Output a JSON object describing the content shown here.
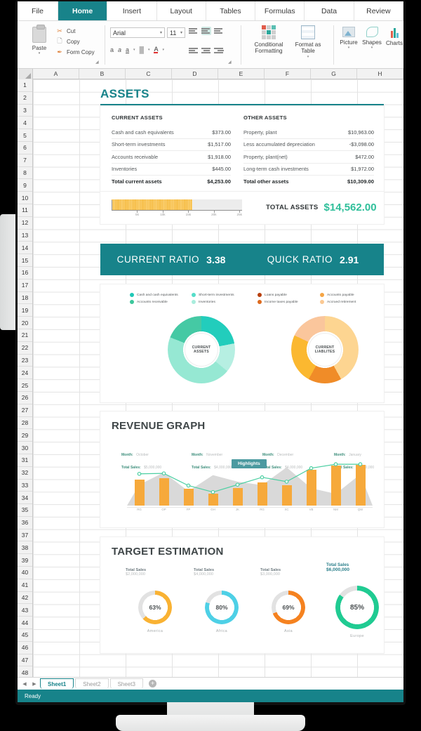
{
  "ribbon": {
    "tabs": [
      {
        "label": "File",
        "active": false
      },
      {
        "label": "Home",
        "active": true
      },
      {
        "label": "Insert",
        "active": false
      },
      {
        "label": "Layout",
        "active": false
      },
      {
        "label": "Tables",
        "active": false
      },
      {
        "label": "Formulas",
        "active": false
      },
      {
        "label": "Data",
        "active": false
      },
      {
        "label": "Review",
        "active": false
      }
    ],
    "clipboard": {
      "paste": "Paste",
      "cut": "Cut",
      "copy": "Copy",
      "format_copy": "Form Copy"
    },
    "font": {
      "family": "Arial",
      "size": "11"
    },
    "commands": {
      "conditional_formatting": "Conditional Formatting",
      "format_as_table": "Format as Table",
      "picture": "Picture",
      "shapes": "Shapes",
      "charts": "Charts"
    }
  },
  "grid": {
    "columns": [
      "A",
      "B",
      "C",
      "D",
      "E",
      "F",
      "G",
      "H"
    ],
    "row_count": 52
  },
  "dashboard": {
    "assets": {
      "title": "ASSETS",
      "current": {
        "heading": "CURRENT ASSETS",
        "rows": [
          {
            "label": "Cash and cash equivalents",
            "value": "$373.00"
          },
          {
            "label": "Short-term investments",
            "value": "$1,517.00"
          },
          {
            "label": "Accounts receivable",
            "value": "$1,918.00"
          },
          {
            "label": "Inventories",
            "value": "$445.00"
          }
        ],
        "total": {
          "label": "Total current assets",
          "value": "$4,253.00"
        }
      },
      "other": {
        "heading": "OTHER ASSETS",
        "rows": [
          {
            "label": "Property, plant",
            "value": "$10,963.00"
          },
          {
            "label": "Less accumulated depreciation",
            "value": "-$3,098.00"
          },
          {
            "label": "Property, plant(net)",
            "value": "$472.00"
          },
          {
            "label": "Long-term cash investments",
            "value": "$1,972.00"
          }
        ],
        "total": {
          "label": "Total other assets",
          "value": "$10,309.00"
        }
      },
      "total_assets": {
        "label": "TOTAL ASSETS",
        "value": "$14,562.00",
        "bar_percent": 62,
        "axis_ticks": [
          "5k",
          "10k",
          "15k",
          "20k",
          "25k"
        ]
      }
    },
    "ratios": [
      {
        "name": "CURRENT RATIO",
        "value": "3.38"
      },
      {
        "name": "QUICK RATIO",
        "value": "2.91"
      }
    ],
    "donuts": {
      "assets": {
        "center_line1": "CURRENT",
        "center_line2": "ASSETS",
        "legend": [
          {
            "label": "Cash and cash equivalents",
            "color": "#1fc8b6"
          },
          {
            "label": "Short-term investments",
            "color": "#55ddc9"
          },
          {
            "label": "Accounts receivable",
            "color": "#3cc79c"
          },
          {
            "label": "Inventories",
            "color": "#a9eddd"
          }
        ],
        "segments": [
          {
            "name": "Cash and cash equivalents",
            "value": 22,
            "color": "#22cdbc"
          },
          {
            "name": "Inventories",
            "value": 14,
            "color": "#b6efe2"
          },
          {
            "name": "Short-term investments",
            "value": 45,
            "color": "#96e8d3"
          },
          {
            "name": "Accounts receivable",
            "value": 19,
            "color": "#45c9a4"
          }
        ]
      },
      "liabilities": {
        "center_line1": "CURRENT",
        "center_line2": "LIABLITES",
        "legend": [
          {
            "label": "Loans payable",
            "color": "#b8400d"
          },
          {
            "label": "Accounts payable",
            "color": "#f5a545"
          },
          {
            "label": "Income taxes payable",
            "color": "#dd6a1e"
          },
          {
            "label": "Accrued retirement",
            "color": "#fbc993"
          }
        ],
        "segments": [
          {
            "name": "Accounts payable",
            "value": 42,
            "color": "#fdd591"
          },
          {
            "name": "Income taxes payable",
            "value": 16,
            "color": "#f08c28"
          },
          {
            "name": "Loans payable",
            "value": 24,
            "color": "#fbb830"
          },
          {
            "name": "Accrued retirement",
            "value": 18,
            "color": "#fac69c"
          }
        ]
      }
    },
    "revenue": {
      "title": "REVENUE GRAPH",
      "months": [
        {
          "month_key": "Month:",
          "month": "October",
          "sales_key": "Total Sales:",
          "sales": "$5,000,000"
        },
        {
          "month_key": "Month:",
          "month": "November",
          "sales_key": "Total Sales:",
          "sales": "$4,000,000"
        },
        {
          "month_key": "Month:",
          "month": "December",
          "sales_key": "Total Sales:",
          "sales": "$4,000,000"
        },
        {
          "month_key": "Month:",
          "month": "January",
          "sales_key": "Total Sales:",
          "sales": "$4,000,000"
        }
      ],
      "highlight_pill": "Highlights",
      "chart": {
        "categories": [
          "RG",
          "OP",
          "FP",
          "GH",
          "JK",
          "RG",
          "XC",
          "VB",
          "NM",
          "QW"
        ],
        "bars": [
          60,
          63,
          38,
          27,
          41,
          53,
          47,
          83,
          92,
          93
        ],
        "line": [
          73,
          74,
          46,
          31,
          48,
          65,
          55,
          86,
          95,
          95
        ],
        "area": [
          48,
          76,
          33,
          70,
          55,
          47,
          88,
          40,
          27,
          72
        ]
      }
    },
    "target": {
      "title": "TARGET ESTIMATION",
      "kpis": [
        {
          "label": "Total Sales",
          "value": "$2,000,000",
          "highlight": false
        },
        {
          "label": "Total Sales",
          "value": "$4,000,000",
          "highlight": false
        },
        {
          "label": "Total Sales",
          "value": "$3,000,000",
          "highlight": false
        },
        {
          "label": "Total Sales",
          "value": "$6,000,000",
          "highlight": true
        }
      ],
      "gauges": [
        {
          "name": "America",
          "percent": "63%",
          "value": 63,
          "color": "#f9b233"
        },
        {
          "name": "Africa",
          "percent": "80%",
          "value": 80,
          "color": "#4ed0e6"
        },
        {
          "name": "Asia",
          "percent": "69%",
          "value": 69,
          "color": "#f58220"
        },
        {
          "name": "Europe",
          "percent": "85%",
          "value": 85,
          "color": "#20cb92"
        }
      ]
    }
  },
  "sheet_tabs": [
    {
      "label": "Sheet1",
      "active": true
    },
    {
      "label": "Sheet2",
      "active": false
    },
    {
      "label": "Sheet3",
      "active": false
    }
  ],
  "add_sheet_label": "+",
  "status": {
    "text": "Ready"
  },
  "colors": {
    "accent_teal": "#17838a",
    "amber": "#f6a93b",
    "green": "#2fbf9a"
  }
}
